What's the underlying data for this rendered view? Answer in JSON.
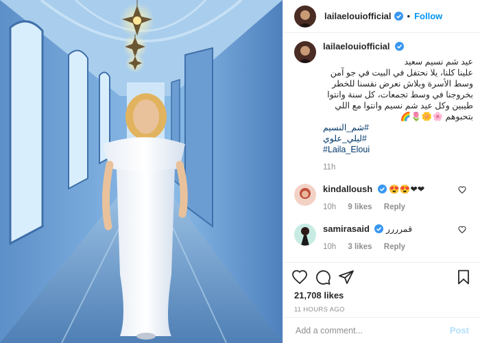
{
  "post": {
    "username": "lailaelouiofficial",
    "follow_label": "Follow",
    "dot": "•",
    "caption_lines": [
      "عيد شم نسيم سعيد",
      "علينا كلنا، يلا نحتفل في البيت في جو آمن",
      "وسط الأسرة وبلاش نعرض نفسنا للخطر",
      "بخروجنا في وسط تجمعات، كل سنة وانتوا",
      "طيبين وكل عيد شم نسيم وانتوا مع اللي",
      "بتحبوهم 🌸🌼🌷🌈"
    ],
    "hashtags": [
      "#شم_النسيم",
      "#ليلي_علوي",
      "#Laila_Eloui"
    ],
    "caption_time": "11h",
    "likes": "21,708 likes",
    "timestamp": "11 HOURS AGO",
    "comment_placeholder": "Add a comment...",
    "post_label": "Post"
  },
  "comments": [
    {
      "username": "kindalloush",
      "text": "😍😍❤❤",
      "time": "10h",
      "likes": "9 likes",
      "reply": "Reply"
    },
    {
      "username": "samirasaid",
      "text": "قمرررر",
      "time": "10h",
      "likes": "3 likes",
      "reply": "Reply"
    }
  ],
  "colors": {
    "accent": "#0095f6",
    "verified": "#3897f0",
    "link": "#00376b",
    "muted": "#8e8e8e"
  },
  "icons": [
    "verified-badge-icon",
    "heart-icon",
    "comment-icon",
    "share-icon",
    "bookmark-icon"
  ]
}
